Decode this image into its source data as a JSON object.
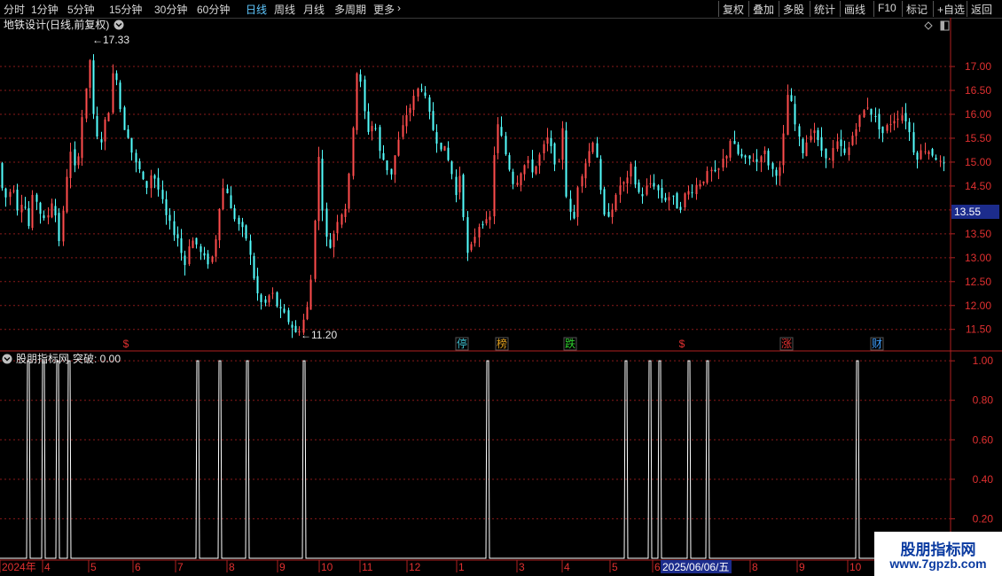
{
  "toolbar": {
    "periods": [
      "分时",
      "1分钟",
      "5分钟",
      "15分钟",
      "30分钟",
      "60分钟",
      "日线",
      "周线",
      "月线",
      "多周期",
      "更多"
    ],
    "active_period": "日线",
    "actions": [
      "复权",
      "叠加",
      "多股",
      "统计",
      "画线",
      "F10",
      "标记",
      "+自选",
      "返回"
    ]
  },
  "main_panel": {
    "title": "地铁设计(日线,前复权)",
    "high_label": "17.33",
    "low_label": "11.20",
    "current_price": "13.55",
    "event_markers": [
      {
        "label": "$",
        "color": "#e03030"
      },
      {
        "label": "停",
        "color": "#40c0d0"
      },
      {
        "label": "榜",
        "color": "#e0a020"
      },
      {
        "label": "跌",
        "color": "#30d030"
      },
      {
        "label": "$",
        "color": "#e03030"
      },
      {
        "label": "涨",
        "color": "#e03030"
      },
      {
        "label": "财",
        "color": "#40a0ff"
      }
    ]
  },
  "indicator_panel": {
    "title": "股朋指标网",
    "value_label": "突破: 0.00"
  },
  "x_axis": {
    "labels": [
      "2024年",
      "4",
      "5",
      "6",
      "7",
      "8",
      "9",
      "10",
      "11",
      "12",
      "1",
      "3",
      "4",
      "5",
      "6",
      "8",
      "9",
      "10"
    ],
    "cursor_date": "2025/06/06/五"
  },
  "watermark": {
    "line1": "股朋指标网",
    "line2": "www.7gpzb.com"
  },
  "colors": {
    "up": "#ff4d4d",
    "down": "#54ffff",
    "grid": "#8a1a1a",
    "border": "#b02020",
    "axis_text": "#e03030"
  },
  "chart_data": [
    {
      "type": "candlestick",
      "title": "地铁设计(日线,前复权)",
      "y_ticks": [
        11.5,
        12.0,
        12.5,
        13.0,
        13.5,
        14.0,
        14.5,
        15.0,
        15.5,
        16.0,
        16.5,
        17.0
      ],
      "ylim": [
        11.05,
        17.65
      ],
      "path": [
        [
          0,
          15.3
        ],
        [
          5,
          14.5
        ],
        [
          12,
          14.2
        ],
        [
          18,
          14.6
        ],
        [
          24,
          14.0
        ],
        [
          30,
          14.3
        ],
        [
          36,
          13.6
        ],
        [
          42,
          14.4
        ],
        [
          48,
          14.0
        ],
        [
          55,
          13.7
        ],
        [
          62,
          14.2
        ],
        [
          68,
          13.8
        ],
        [
          72,
          13.2
        ],
        [
          78,
          14.6
        ],
        [
          84,
          15.2
        ],
        [
          90,
          14.7
        ],
        [
          95,
          15.8
        ],
        [
          100,
          16.3
        ],
        [
          105,
          17.2
        ],
        [
          110,
          15.8
        ],
        [
          116,
          15.3
        ],
        [
          122,
          15.8
        ],
        [
          128,
          16.2
        ],
        [
          133,
          17.2
        ],
        [
          137,
          16.5
        ],
        [
          142,
          15.8
        ],
        [
          148,
          15.6
        ],
        [
          155,
          15.0
        ],
        [
          162,
          14.8
        ],
        [
          168,
          14.4
        ],
        [
          175,
          14.8
        ],
        [
          180,
          14.6
        ],
        [
          186,
          14.2
        ],
        [
          192,
          13.8
        ],
        [
          198,
          13.6
        ],
        [
          205,
          13.4
        ],
        [
          212,
          12.8
        ],
        [
          218,
          13.4
        ],
        [
          225,
          13.3
        ],
        [
          232,
          13.0
        ],
        [
          240,
          12.9
        ],
        [
          245,
          13.1
        ],
        [
          252,
          14.2
        ],
        [
          258,
          14.6
        ],
        [
          264,
          14.0
        ],
        [
          270,
          13.8
        ],
        [
          276,
          13.6
        ],
        [
          282,
          13.4
        ],
        [
          290,
          12.6
        ],
        [
          296,
          12.1
        ],
        [
          302,
          12.0
        ],
        [
          310,
          12.3
        ],
        [
          318,
          11.9
        ],
        [
          324,
          11.8
        ],
        [
          332,
          11.6
        ],
        [
          338,
          11.4
        ],
        [
          344,
          11.6
        ],
        [
          350,
          11.9
        ],
        [
          355,
          12.6
        ],
        [
          360,
          14.2
        ],
        [
          364,
          15.3
        ],
        [
          368,
          13.9
        ],
        [
          374,
          13.1
        ],
        [
          380,
          13.5
        ],
        [
          386,
          13.9
        ],
        [
          392,
          14.0
        ],
        [
          396,
          14.2
        ],
        [
          400,
          15.4
        ],
        [
          403,
          16.0
        ],
        [
          406,
          16.9
        ],
        [
          410,
          16.7
        ],
        [
          414,
          16.1
        ],
        [
          420,
          15.6
        ],
        [
          426,
          15.9
        ],
        [
          432,
          15.2
        ],
        [
          438,
          15.0
        ],
        [
          444,
          14.7
        ],
        [
          450,
          15.2
        ],
        [
          456,
          15.6
        ],
        [
          462,
          16.0
        ],
        [
          468,
          16.2
        ],
        [
          474,
          16.5
        ],
        [
          480,
          16.6
        ],
        [
          486,
          16.1
        ],
        [
          492,
          15.7
        ],
        [
          498,
          15.4
        ],
        [
          504,
          15.3
        ],
        [
          510,
          15.0
        ],
        [
          516,
          14.6
        ],
        [
          520,
          14.0
        ],
        [
          524,
          15.3
        ],
        [
          528,
          13.2
        ],
        [
          532,
          13.0
        ],
        [
          538,
          13.4
        ],
        [
          544,
          13.7
        ],
        [
          550,
          13.8
        ],
        [
          556,
          13.6
        ],
        [
          562,
          15.5
        ],
        [
          566,
          15.8
        ],
        [
          572,
          15.3
        ],
        [
          578,
          14.9
        ],
        [
          584,
          14.5
        ],
        [
          590,
          14.8
        ],
        [
          598,
          15.0
        ],
        [
          606,
          14.8
        ],
        [
          614,
          15.2
        ],
        [
          622,
          15.5
        ],
        [
          628,
          15.1
        ],
        [
          634,
          14.9
        ],
        [
          638,
          15.9
        ],
        [
          642,
          14.4
        ],
        [
          646,
          14.0
        ],
        [
          650,
          13.6
        ],
        [
          656,
          14.6
        ],
        [
          662,
          14.9
        ],
        [
          668,
          15.2
        ],
        [
          675,
          15.6
        ],
        [
          680,
          14.5
        ],
        [
          686,
          13.8
        ],
        [
          692,
          14.0
        ],
        [
          698,
          14.2
        ],
        [
          704,
          14.6
        ],
        [
          710,
          14.5
        ],
        [
          716,
          14.9
        ],
        [
          722,
          14.4
        ],
        [
          728,
          14.3
        ],
        [
          734,
          14.5
        ],
        [
          740,
          14.6
        ],
        [
          746,
          14.4
        ],
        [
          752,
          14.2
        ],
        [
          758,
          14.3
        ],
        [
          764,
          14.2
        ],
        [
          770,
          14.0
        ],
        [
          776,
          14.3
        ],
        [
          782,
          14.4
        ],
        [
          788,
          14.5
        ],
        [
          794,
          14.6
        ],
        [
          800,
          14.7
        ],
        [
          806,
          14.8
        ],
        [
          812,
          14.7
        ],
        [
          818,
          15.0
        ],
        [
          824,
          15.2
        ],
        [
          828,
          15.5
        ],
        [
          834,
          15.2
        ],
        [
          840,
          15.1
        ],
        [
          846,
          15.0
        ],
        [
          852,
          15.1
        ],
        [
          858,
          15.0
        ],
        [
          864,
          15.3
        ],
        [
          870,
          15.0
        ],
        [
          876,
          14.8
        ],
        [
          882,
          14.8
        ],
        [
          886,
          14.9
        ],
        [
          890,
          16.3
        ],
        [
          894,
          16.5
        ],
        [
          898,
          16.0
        ],
        [
          904,
          15.5
        ],
        [
          910,
          15.2
        ],
        [
          916,
          15.6
        ],
        [
          922,
          15.7
        ],
        [
          928,
          15.3
        ],
        [
          934,
          15.2
        ],
        [
          940,
          15.0
        ],
        [
          946,
          15.4
        ],
        [
          952,
          15.3
        ],
        [
          958,
          15.1
        ],
        [
          964,
          15.5
        ],
        [
          970,
          15.8
        ],
        [
          976,
          16.0
        ],
        [
          982,
          16.2
        ],
        [
          988,
          16.0
        ],
        [
          994,
          15.8
        ],
        [
          1000,
          15.6
        ],
        [
          1006,
          15.8
        ],
        [
          1012,
          15.9
        ],
        [
          1018,
          16.0
        ],
        [
          1024,
          16.0
        ],
        [
          1030,
          15.6
        ],
        [
          1036,
          15.1
        ],
        [
          1042,
          15.2
        ],
        [
          1048,
          15.3
        ],
        [
          1054,
          15.2
        ],
        [
          1060,
          15.1
        ],
        [
          1066,
          14.9
        ]
      ]
    },
    {
      "type": "line",
      "title": "股朋指标网",
      "y_ticks": [
        0.2,
        0.4,
        0.6,
        0.8,
        1.0
      ],
      "ylim": [
        0.0,
        1.05
      ],
      "spike_positions": [
        32,
        49,
        65,
        78,
        223,
        248,
        279,
        343,
        550,
        706,
        733,
        744,
        777,
        798,
        967
      ],
      "spike_value": 1.0,
      "baseline": 0.0
    }
  ]
}
